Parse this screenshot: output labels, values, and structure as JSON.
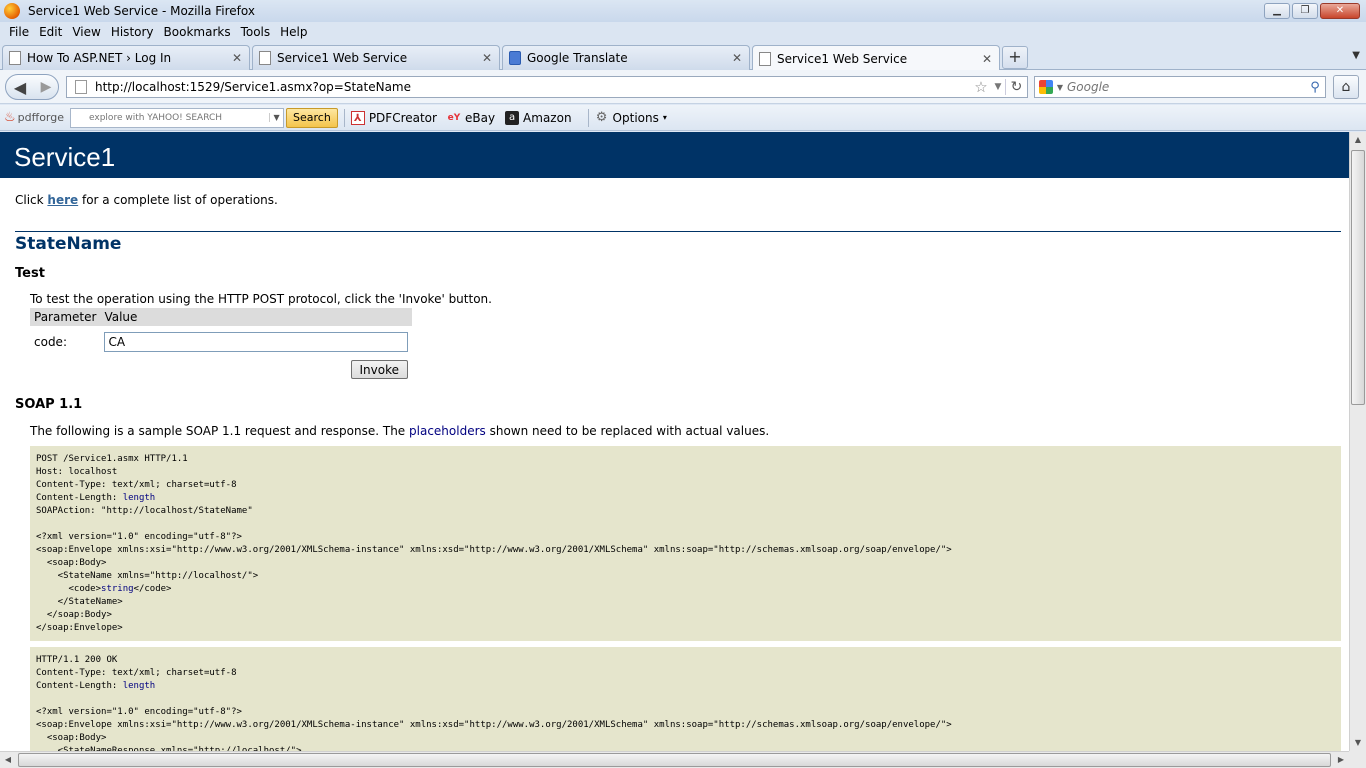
{
  "window": {
    "title": "Service1 Web Service - Mozilla Firefox",
    "minimize": "▁",
    "maximize": "❐",
    "close": "✕"
  },
  "menu": {
    "file": "File",
    "edit": "Edit",
    "view": "View",
    "history": "History",
    "bookmarks": "Bookmarks",
    "tools": "Tools",
    "help": "Help"
  },
  "tabs": [
    {
      "label": "How To ASP.NET › Log In",
      "icon": "page-icon"
    },
    {
      "label": "Service1 Web Service",
      "icon": "page-icon"
    },
    {
      "label": "Google Translate",
      "icon": "google-translate-icon"
    },
    {
      "label": "Service1 Web Service",
      "icon": "page-icon",
      "active": true
    }
  ],
  "nav": {
    "url": "http://localhost:1529/Service1.asmx?op=StateName",
    "search_placeholder": "Google"
  },
  "toolbar": {
    "pdfforge": "pdfforge",
    "yahoo_placeholder": "explore with YAHOO! SEARCH",
    "search_button": "Search",
    "pdfcreator": "PDFCreator",
    "ebay": "eBay",
    "amazon": "Amazon",
    "options": "Options"
  },
  "page": {
    "service_name": "Service1",
    "intro_before": "Click ",
    "intro_link": "here",
    "intro_after": " for a complete list of operations.",
    "operation": "StateName",
    "test_heading": "Test",
    "test_note": "To test the operation using the HTTP POST protocol, click the 'Invoke' button.",
    "param_header": "Parameter",
    "value_header": "Value",
    "param_label": "code:",
    "param_value": "CA",
    "invoke_label": "Invoke",
    "soap_heading": "SOAP 1.1",
    "soap_note_before": "The following is a sample SOAP 1.1 request and response. The ",
    "soap_note_ph": "placeholders",
    "soap_note_after": " shown need to be replaced with actual values.",
    "request_lines": [
      "POST /Service1.asmx HTTP/1.1",
      "Host: localhost",
      "Content-Type: text/xml; charset=utf-8",
      "Content-Length: {length}",
      "SOAPAction: \"http://localhost/StateName\"",
      "",
      "<?xml version=\"1.0\" encoding=\"utf-8\"?>",
      "<soap:Envelope xmlns:xsi=\"http://www.w3.org/2001/XMLSchema-instance\" xmlns:xsd=\"http://www.w3.org/2001/XMLSchema\" xmlns:soap=\"http://schemas.xmlsoap.org/soap/envelope/\">",
      "  <soap:Body>",
      "    <StateName xmlns=\"http://localhost/\">",
      "      <code>{string}</code>",
      "    </StateName>",
      "  </soap:Body>",
      "</soap:Envelope>"
    ],
    "response_lines": [
      "HTTP/1.1 200 OK",
      "Content-Type: text/xml; charset=utf-8",
      "Content-Length: {length}",
      "",
      "<?xml version=\"1.0\" encoding=\"utf-8\"?>",
      "<soap:Envelope xmlns:xsi=\"http://www.w3.org/2001/XMLSchema-instance\" xmlns:xsd=\"http://www.w3.org/2001/XMLSchema\" xmlns:soap=\"http://schemas.xmlsoap.org/soap/envelope/\">",
      "  <soap:Body>",
      "    <StateNameResponse xmlns=\"http://localhost/\">"
    ]
  },
  "colors": {
    "header_band": "#003366",
    "code_bg": "#e5e5cc",
    "placeholder": "#000080"
  }
}
